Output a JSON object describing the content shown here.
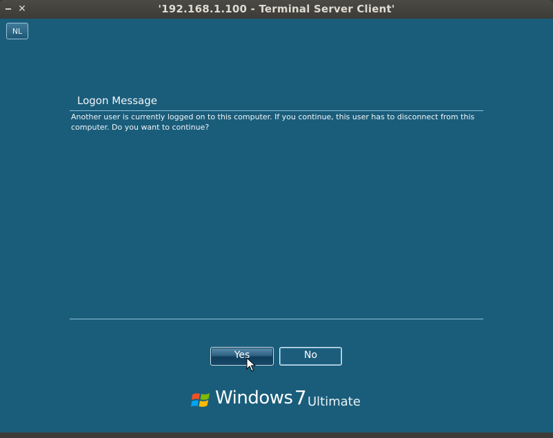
{
  "window": {
    "title": "'192.168.1.100 - Terminal Server Client'",
    "minimize_glyph": "‒",
    "close_glyph": "✕"
  },
  "remote": {
    "keyboard_layout": "NL",
    "dialog": {
      "title": "Logon Message",
      "message": "Another user is currently logged on to this computer. If you continue, this user has to disconnect from this computer. Do you want to continue?",
      "yes_label": "Yes",
      "no_label": "No"
    },
    "branding": {
      "windows": "Windows",
      "version": "7",
      "edition": "Ultimate"
    }
  },
  "colors": {
    "desktop_bg": "#1a5d7b",
    "titlebar_bg": "#3c3b37",
    "rule": "#8ec3dc"
  },
  "icons": {
    "window_minimize": "minimize-icon",
    "window_close": "close-icon",
    "windows_flag": "windows-flag-icon",
    "mouse_cursor": "arrow-cursor-icon"
  }
}
